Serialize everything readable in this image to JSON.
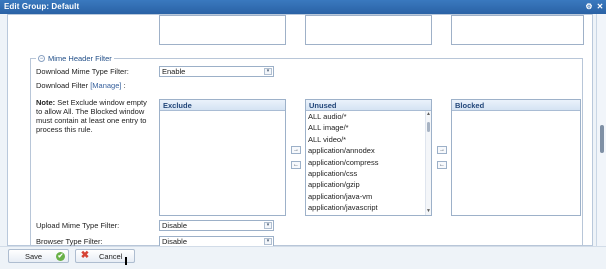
{
  "window": {
    "title": "Edit Group: Default",
    "buttons": {
      "settings": "⚙",
      "close": "✕"
    }
  },
  "section": {
    "legend": "Mime Header Filter",
    "toggle_icon": "−"
  },
  "fields": {
    "download_mime_type_filter_label": "Download Mime Type Filter:",
    "download_mime_type_filter_value": "Enable",
    "download_filter_label": "Download Filter",
    "manage_link": "[Manage]",
    "download_filter_colon": ":",
    "note_title": "Note:",
    "note_text": "Set Exclude window empty to allow All. The Blocked window must contain at least one entry to process this rule.",
    "upload_mime_type_filter_label": "Upload Mime Type Filter:",
    "upload_mime_type_filter_value": "Disable",
    "browser_type_filter_label": "Browser Type Filter:",
    "browser_type_filter_value": "Disable"
  },
  "lists": {
    "exclude": {
      "header": "Exclude",
      "items": []
    },
    "unused": {
      "header": "Unused",
      "items": [
        "ALL audio/*",
        "ALL image/*",
        "ALL video/*",
        "application/annodex",
        "application/compress",
        "application/css",
        "application/gzip",
        "application/java-vm",
        "application/javascript"
      ]
    },
    "blocked": {
      "header": "Blocked",
      "items": []
    }
  },
  "buttons": {
    "move_right": "→",
    "move_left": "←",
    "save": "Save",
    "cancel": "Cancel",
    "save_icon": "✔",
    "cancel_icon": "✖"
  },
  "select_arrow": "▾",
  "scroll_arrow_up": "▲",
  "scroll_arrow_down": "▼"
}
